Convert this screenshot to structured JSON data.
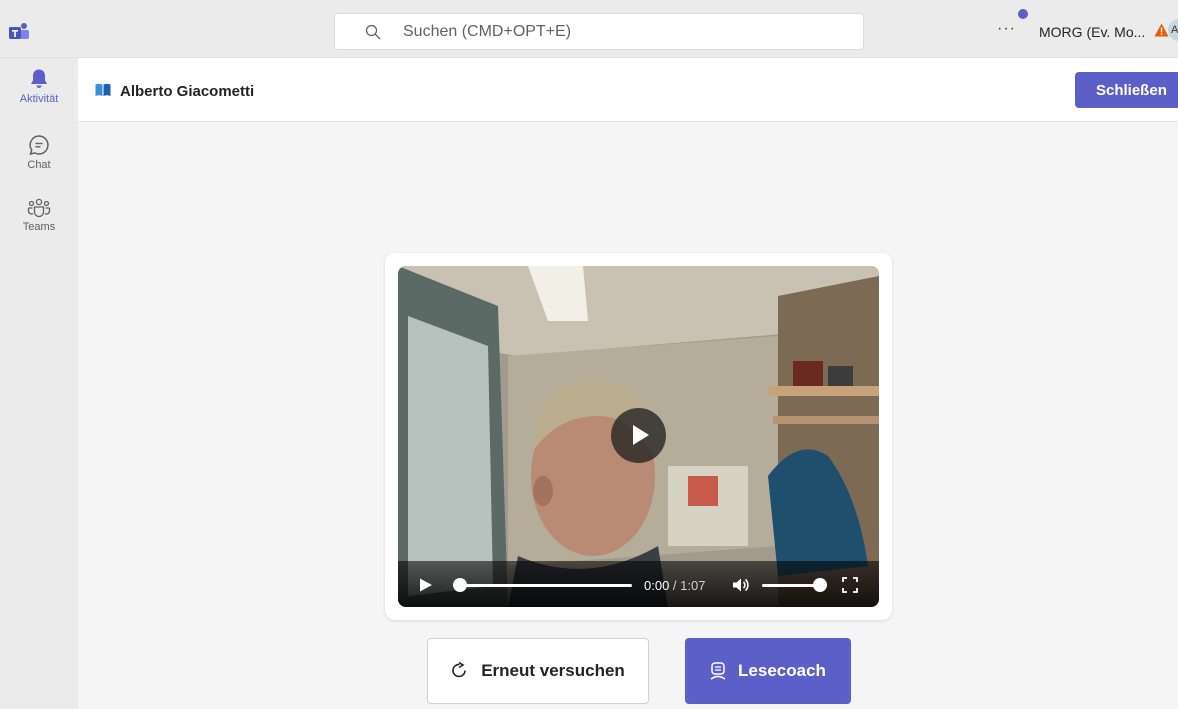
{
  "topbar": {
    "search_placeholder": "Suchen (CMD+OPT+E)",
    "more_label": "···",
    "org_name": "MORG (Ev. Mo...",
    "avatar_initial": "A"
  },
  "rail": {
    "items": [
      {
        "label": "Aktivität",
        "icon": "bell-icon",
        "active": true
      },
      {
        "label": "Chat",
        "icon": "chat-icon",
        "active": false
      },
      {
        "label": "Teams",
        "icon": "teams-icon",
        "active": false
      }
    ]
  },
  "header": {
    "title": "Alberto Giacometti",
    "close_label": "Schließen"
  },
  "video": {
    "current_time": "0:00",
    "separator": " / ",
    "duration": "1:07",
    "progress": 0,
    "volume": 1
  },
  "actions": {
    "retry_label": "Erneut versuchen",
    "coach_label": "Lesecoach"
  },
  "colors": {
    "accent": "#5b5fc7",
    "warning": "#e65c00"
  }
}
